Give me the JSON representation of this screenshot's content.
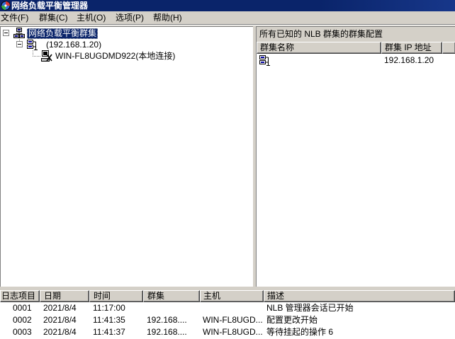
{
  "colors": {
    "titlebar": "#0a246a",
    "titlebar_text": "#ffffff",
    "face": "#d4d0c8",
    "window": "#ffffff",
    "selection": "#0a246a",
    "selection_text": "#ffffff",
    "shadow": "#808080"
  },
  "window": {
    "title": "网络负载平衡管理器",
    "icon": "nlb-manager-icon"
  },
  "menu": {
    "items": [
      {
        "label": "文件(F)"
      },
      {
        "label": "群集(C)"
      },
      {
        "label": "主机(O)"
      },
      {
        "label": "选项(P)"
      },
      {
        "label": "帮助(H)"
      }
    ]
  },
  "tree": {
    "root": {
      "label": "网络负载平衡群集",
      "icon": "nlb-clusters-icon",
      "expanded": true,
      "selected": true
    },
    "cluster": {
      "label": "(192.168.1.20)",
      "icon": "cluster-icon",
      "expanded": true
    },
    "host": {
      "label": "WIN-FL8UGDMD922(本地连接)",
      "icon": "host-icon"
    }
  },
  "details": {
    "heading": "所有已知的 NLB 群集的群集配置",
    "columns": [
      "群集名称",
      "群集 IP 地址"
    ],
    "rows": [
      {
        "icon": "cluster-icon",
        "cluster_ip": "192.168.1.20"
      }
    ]
  },
  "log": {
    "columns": [
      "日志项目",
      "日期",
      "时间",
      "群集",
      "主机",
      "描述"
    ],
    "rows": [
      {
        "entry": "0001",
        "date": "2021/8/4",
        "time": "11:17:00",
        "cluster": "",
        "host": "",
        "description": "NLB 管理器会话已开始"
      },
      {
        "entry": "0002",
        "date": "2021/8/4",
        "time": "11:41:35",
        "cluster": "192.168....",
        "host": "WIN-FL8UGD...",
        "description": "配置更改开始"
      },
      {
        "entry": "0003",
        "date": "2021/8/4",
        "time": "11:41:37",
        "cluster": "192.168....",
        "host": "WIN-FL8UGD...",
        "description": "等待挂起的操作 6"
      }
    ]
  }
}
